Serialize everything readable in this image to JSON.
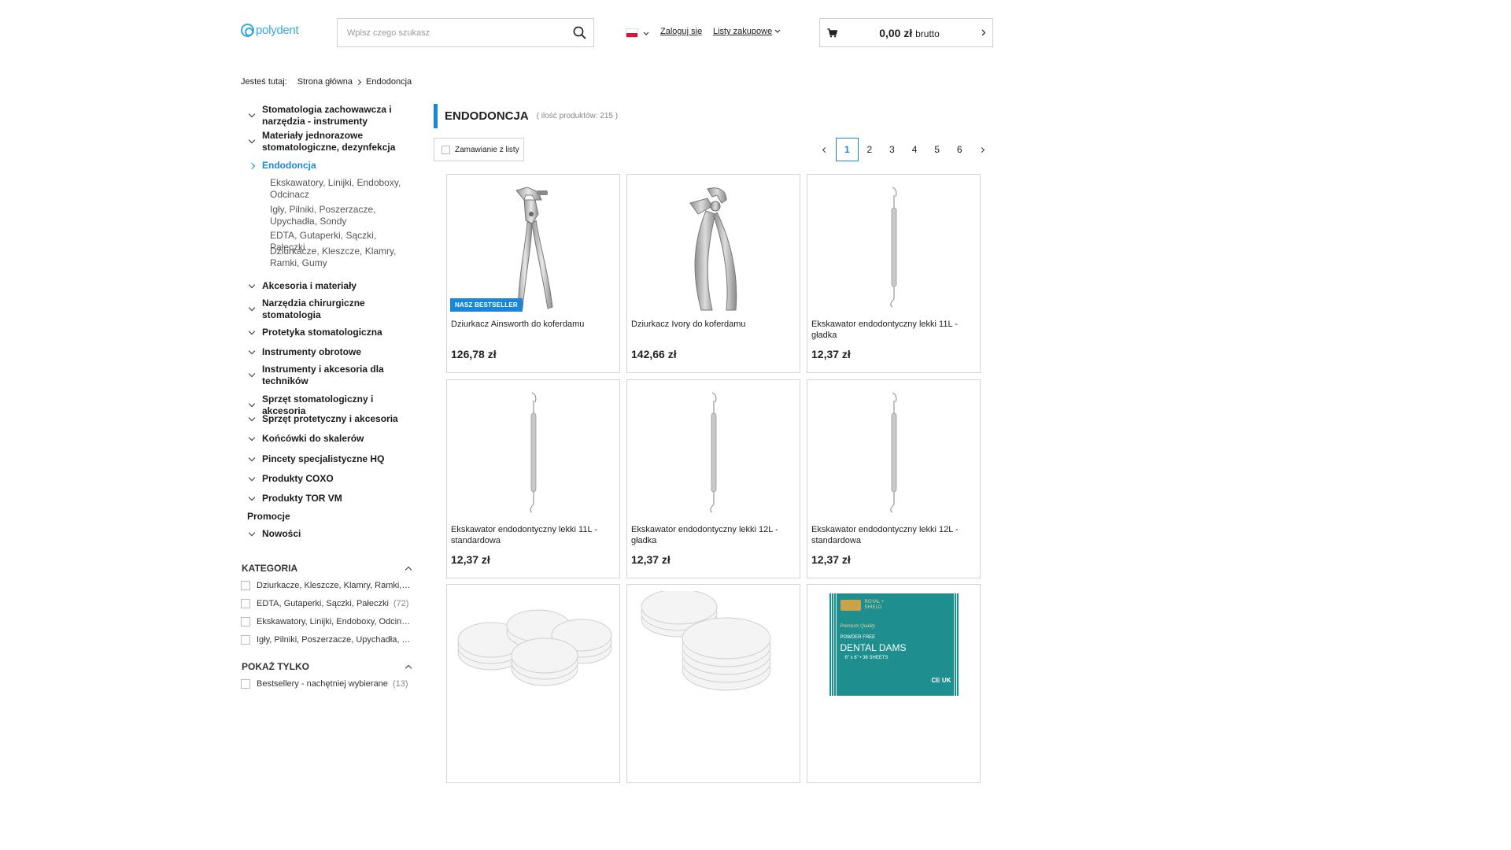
{
  "header": {
    "logo_text": "polydent",
    "search_placeholder": "Wpisz czego szukasz",
    "login_label": "Zaloguj się",
    "lists_label": "Listy zakupowe",
    "cart_amount": "0,00 zł",
    "cart_suffix": "brutto"
  },
  "breadcrumb": {
    "prefix": "Jesteś tutaj:",
    "items": [
      "Strona główna",
      "Endodoncja"
    ]
  },
  "sidebar": {
    "categories": [
      "Stomatologia zachowawcza i narzędzia - instrumenty",
      "Materiały jednorazowe stomatologiczne, dezynfekcja",
      "Endodoncja",
      "Akcesoria i materiały",
      "Narzędzia chirurgiczne stomatologia",
      "Protetyka stomatologiczna",
      "Instrumenty obrotowe",
      "Instrumenty i akcesoria dla techników",
      "Sprzęt stomatologiczny i akcesoria",
      "Sprzęt protetyczny i akcesoria",
      "Końcówki do skalerów",
      "Pincety specjalistyczne HQ",
      "Produkty COXO",
      "Produkty TOR VM",
      "Promocje",
      "Nowości"
    ],
    "subcategories": [
      "Ekskawatory, Linijki, Endoboxy, Odcinacz",
      "Igły, Pilniki, Poszerzacze, Upychadła, Sondy",
      "EDTA, Gutaperki, Sączki, Pałeczki",
      "Dziurkacze, Kleszcze, Klamry, Ramki, Gumy"
    ]
  },
  "filters": {
    "kategoria_title": "KATEGORIA",
    "kategoria_items": [
      {
        "label": "Dziurkacze, Kleszcze, Klamry, Ramki, Gumy",
        "count": ""
      },
      {
        "label": "EDTA, Gutaperki, Sączki, Pałeczki",
        "count": "(72)"
      },
      {
        "label": "Ekskawatory, Linijki, Endoboxy, Odcinacz",
        "count": ""
      },
      {
        "label": "Igły, Pilniki, Poszerzacze, Upychadła, Sondy",
        "count": ""
      }
    ],
    "show_title": "POKAŻ TYLKO",
    "show_items": [
      {
        "label": "Bestsellery - nachętniej wybierane",
        "count": "(13)"
      }
    ]
  },
  "main": {
    "title": "ENDODONCJA",
    "count_text": "( ilość produktów: 215 )",
    "order_from_list": "Zamawianie z listy",
    "pages": [
      "1",
      "2",
      "3",
      "4",
      "5",
      "6"
    ],
    "current_page": "1"
  },
  "products": [
    {
      "name": "Dziurkacz Ainsworth do koferdamu",
      "price": "126,78 zł",
      "badge": "NASZ BESTSELLER",
      "icon": "punch-pliers"
    },
    {
      "name": "Dziurkacz Ivory do koferdamu",
      "price": "142,66 zł",
      "badge": "",
      "icon": "punch-pliers-ivory"
    },
    {
      "name": "Ekskawator endodontyczny lekki 11L - gładka",
      "price": "12,37 zł",
      "badge": "",
      "icon": "excavator"
    },
    {
      "name": "Ekskawator endodontyczny lekki 11L - standardowa",
      "price": "12,37 zł",
      "badge": "",
      "icon": "excavator"
    },
    {
      "name": "Ekskawator endodontyczny lekki 12L - gładka",
      "price": "12,37 zł",
      "badge": "",
      "icon": "excavator"
    },
    {
      "name": "Ekskawator endodontyczny lekki 12L - standardowa",
      "price": "12,37 zł",
      "badge": "",
      "icon": "excavator"
    },
    {
      "name": "",
      "price": "",
      "badge": "",
      "icon": "cotton-pads"
    },
    {
      "name": "",
      "price": "",
      "badge": "",
      "icon": "cotton-pads"
    },
    {
      "name": "",
      "price": "",
      "badge": "",
      "icon": "dental-dams-box",
      "box_text": {
        "brand": "ROYAL + SHIELD",
        "quality": "Premium Quality",
        "powder": "POWDER FREE",
        "title": "DENTAL DAMS",
        "size": "6\" x 6\" • 36 SHEETS",
        "marks": "CE UK"
      }
    }
  ],
  "colors": {
    "accent": "#1a87d6",
    "logo": "#3aa6dd",
    "border": "#d4d4d4"
  }
}
